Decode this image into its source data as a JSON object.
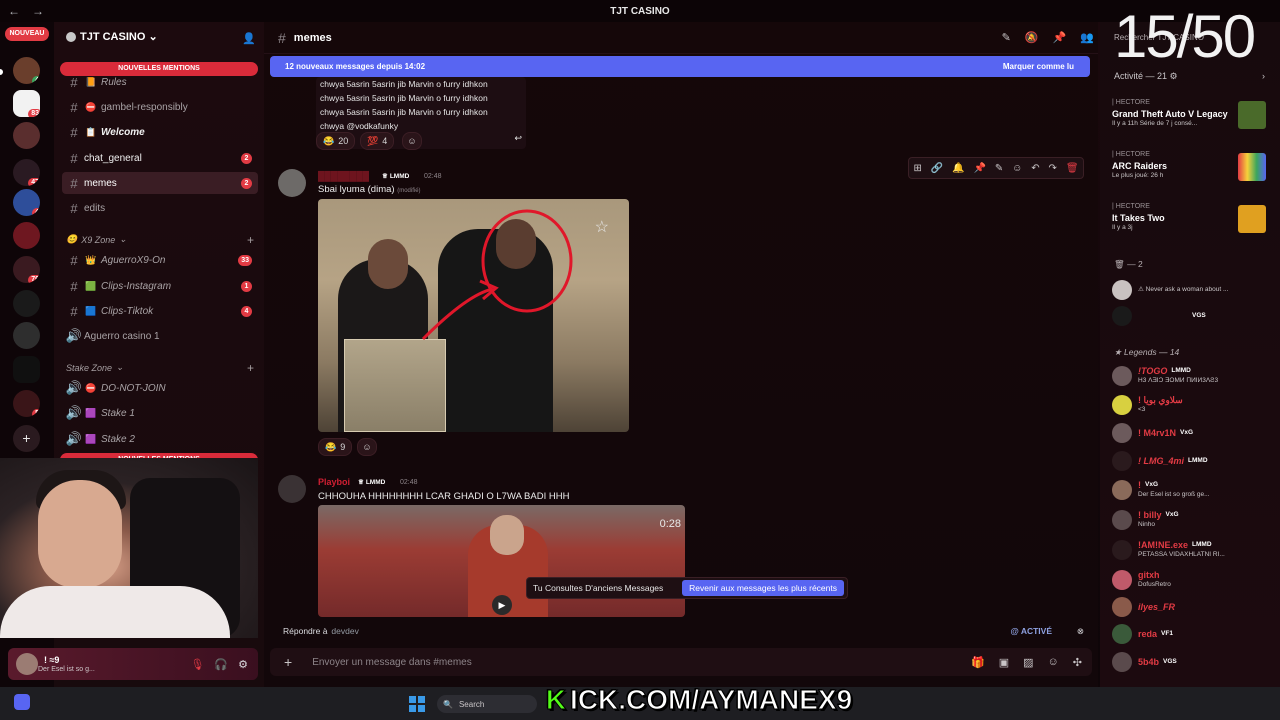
{
  "window": {
    "title": "TJT CASINO",
    "back": "←",
    "forward": "→"
  },
  "rail": {
    "new_label": "NOUVEAU"
  },
  "server": {
    "name": "TJT CASINO ⌄"
  },
  "sidebar": {
    "mentions_top": "NOUVELLES MENTIONS",
    "mentions_bottom": "NOUVELLES MENTIONS",
    "channels": [
      {
        "name": "Rules",
        "emoji": "📙",
        "italic": true
      },
      {
        "name": "gambel-responsibly",
        "emoji": "⛔"
      },
      {
        "name": "Welcome",
        "emoji": "📋",
        "italic": true,
        "bold": true
      },
      {
        "name": "chat_general",
        "badge": "2",
        "bold": true
      },
      {
        "name": "memes",
        "badge": "2",
        "active": true
      },
      {
        "name": "edits"
      },
      {
        "name": "AguerroX9-On",
        "emoji": "👑",
        "badge": "33",
        "italic": true
      },
      {
        "name": "Clips-Instagram",
        "emoji": "🟩",
        "badge": "1",
        "italic": true
      },
      {
        "name": "Clips-Tiktok",
        "emoji": "🟦",
        "badge": "4",
        "italic": true
      },
      {
        "name": "Aguerro casino 1",
        "voice": true
      },
      {
        "name": "DO-NOT-JOIN",
        "emoji": "⛔",
        "voice": true,
        "italic": true
      },
      {
        "name": "Stake 1",
        "emoji": "🟪",
        "voice": true,
        "italic": true
      },
      {
        "name": "Stake 2",
        "emoji": "🟪",
        "voice": true,
        "italic": true
      }
    ],
    "categories": {
      "x9": "X9 Zone",
      "stake": "Stake Zone"
    }
  },
  "user_panel": {
    "name": "! ≈9",
    "status": "Der Esel ist so g..."
  },
  "header": {
    "channel": "memes"
  },
  "new_messages": {
    "text": "12 nouveaux messages depuis 14:02",
    "mark": "Marquer comme lu"
  },
  "quote": {
    "lines": [
      "chwya 5asrin 5asrin jib Marvin o furry idhkon",
      "chwya 5asrin 5asrin jib Marvin o furry idhkon",
      "chwya 5asrin 5asrin jib Marvin o furry idhkon",
      "chwya @vodkafunky"
    ]
  },
  "reactions1": [
    {
      "emoji": "😂",
      "count": "20"
    },
    {
      "emoji": "💯",
      "count": "4"
    }
  ],
  "msg1": {
    "tag": "LMMD",
    "time": "02:48",
    "text": "Sbai lyuma (dima)",
    "modified": "(modifié)"
  },
  "reactions2": [
    {
      "emoji": "😂",
      "count": "9"
    }
  ],
  "msg2": {
    "author": "Playboi",
    "tag": "LMMD",
    "time": "02:48",
    "text": "CHHOUHA HHHHHHHH LCAR GHADI O L7WA BADI HHH",
    "duration": "0:28"
  },
  "old_bar": {
    "text": "Tu Consultes D'anciens Messages",
    "button": "Revenir aux messages les plus récents"
  },
  "reply": {
    "label": "Répondre à",
    "user": "devdev",
    "active": "@ ACTIVÉ"
  },
  "composer": {
    "placeholder": "Envoyer un message dans #memes"
  },
  "right": {
    "counter": "15/50",
    "search": "Rechercher TJT CASINO",
    "activity": "Activité — 21 ⚙",
    "items": [
      {
        "who": "| HECTORE",
        "game": "Grand Theft Auto V Legacy",
        "sub": "Il y a 11h   Série de 7 j consé..."
      },
      {
        "who": "| HECTORE",
        "game": "ARC Raiders",
        "sub": "Le plus joué: 26 h"
      },
      {
        "who": "| HECTORE",
        "game": "It Takes Two",
        "sub": "Il y a 3j"
      }
    ],
    "group_count": "— 2",
    "group_member": {
      "status": "Never ask a woman about ..."
    },
    "group_member2": {
      "tag": "VGS"
    },
    "legends": "Legends — 14",
    "members": [
      {
        "name": "!TOGO",
        "tag": "LMMD",
        "status": "H3 ɅƎIϽ ƎOMИ ΠИIИ3ɅƧ3"
      },
      {
        "name": "! سلاوي بويا",
        "tag": "",
        "status": "<3"
      },
      {
        "name": "! M4rv1N",
        "tag": "VxG",
        "status": ""
      },
      {
        "name": "! LMG_4mi",
        "tag": "LMMD",
        "status": ""
      },
      {
        "name": "!",
        "tag": "VxG",
        "status": "Der Esel ist so groß ge..."
      },
      {
        "name": "! billy",
        "tag": "VxG",
        "status": "Ninho"
      },
      {
        "name": "!AM!NE.exe",
        "tag": "LMMD",
        "status": "PETASSA VIDAXHLATNI RI..."
      },
      {
        "name": "gitxh",
        "tag": "",
        "status": "DofusRetro"
      },
      {
        "name": "ilyes_FR",
        "tag": "",
        "status": ""
      },
      {
        "name": "reda",
        "tag": "VF1",
        "status": ""
      },
      {
        "name": "5b4b",
        "tag": "VGS",
        "status": ""
      }
    ]
  },
  "taskbar": {
    "search": "Search"
  },
  "overlay": {
    "kick": "KICK.COM/AYMANEX9",
    "kick_k": "K"
  }
}
